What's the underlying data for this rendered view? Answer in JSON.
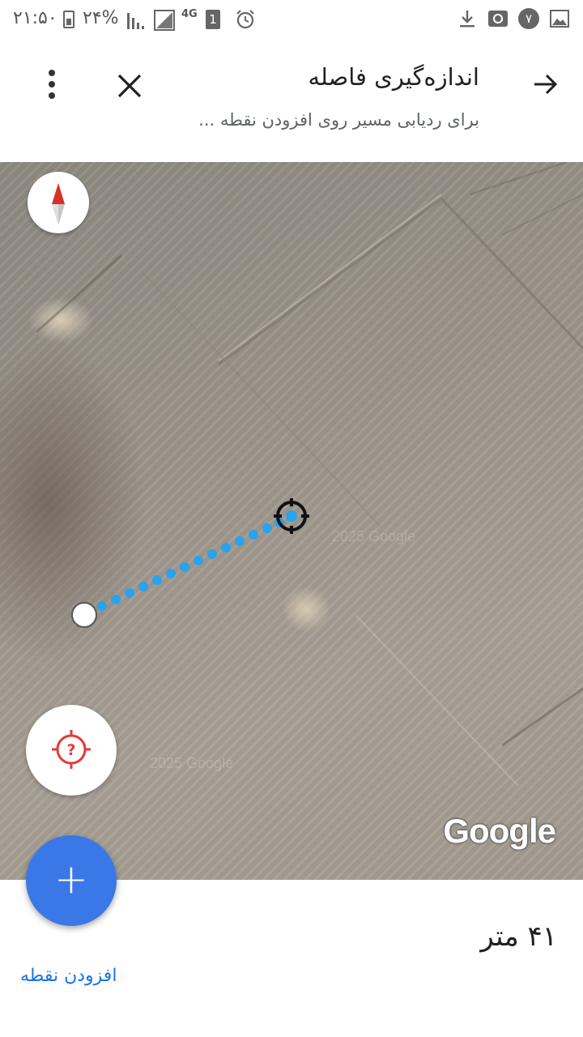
{
  "status_bar": {
    "time": "۲۱:۵۰",
    "battery_percent": "۲۴%",
    "network": "4G",
    "sim_slot": "1",
    "notification_badge": "۷",
    "icons": [
      "battery-icon",
      "signal-icon",
      "signal-icon",
      "alarm-icon",
      "download-icon",
      "at-icon",
      "image-icon"
    ]
  },
  "header": {
    "title": "اندازه‌گیری فاصله",
    "subtitle": "برای ردیابی مسیر روی افزودن نقطه ...",
    "back_icon": "arrow-forward-icon",
    "close_icon": "close-icon",
    "more_icon": "more-vert-icon"
  },
  "map": {
    "logo": "Google",
    "compass_icon": "compass-icon",
    "locate_icon": "location-unknown-icon",
    "route_color": "#29a3ec",
    "locate_color": "#e53935"
  },
  "fab": {
    "label": "+",
    "color": "#3b78e7"
  },
  "bottom": {
    "distance": "۴۱ متر",
    "add_point_label": "افزودن نقطه"
  }
}
